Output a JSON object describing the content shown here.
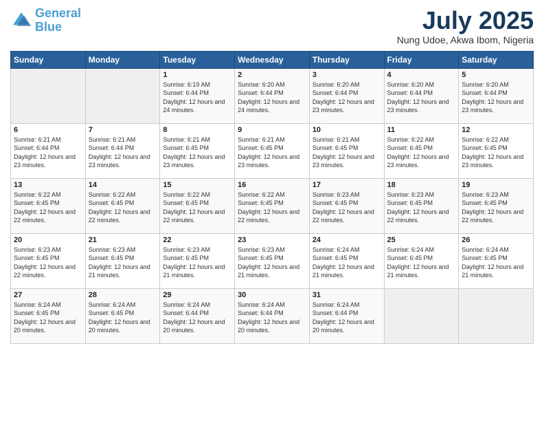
{
  "logo": {
    "text_general": "General",
    "text_blue": "Blue"
  },
  "header": {
    "title": "July 2025",
    "subtitle": "Nung Udoe, Akwa Ibom, Nigeria"
  },
  "weekdays": [
    "Sunday",
    "Monday",
    "Tuesday",
    "Wednesday",
    "Thursday",
    "Friday",
    "Saturday"
  ],
  "weeks": [
    [
      {
        "day": "",
        "sunrise": "",
        "sunset": "",
        "daylight": ""
      },
      {
        "day": "",
        "sunrise": "",
        "sunset": "",
        "daylight": ""
      },
      {
        "day": "1",
        "sunrise": "Sunrise: 6:19 AM",
        "sunset": "Sunset: 6:44 PM",
        "daylight": "Daylight: 12 hours and 24 minutes."
      },
      {
        "day": "2",
        "sunrise": "Sunrise: 6:20 AM",
        "sunset": "Sunset: 6:44 PM",
        "daylight": "Daylight: 12 hours and 24 minutes."
      },
      {
        "day": "3",
        "sunrise": "Sunrise: 6:20 AM",
        "sunset": "Sunset: 6:44 PM",
        "daylight": "Daylight: 12 hours and 23 minutes."
      },
      {
        "day": "4",
        "sunrise": "Sunrise: 6:20 AM",
        "sunset": "Sunset: 6:44 PM",
        "daylight": "Daylight: 12 hours and 23 minutes."
      },
      {
        "day": "5",
        "sunrise": "Sunrise: 6:20 AM",
        "sunset": "Sunset: 6:44 PM",
        "daylight": "Daylight: 12 hours and 23 minutes."
      }
    ],
    [
      {
        "day": "6",
        "sunrise": "Sunrise: 6:21 AM",
        "sunset": "Sunset: 6:44 PM",
        "daylight": "Daylight: 12 hours and 23 minutes."
      },
      {
        "day": "7",
        "sunrise": "Sunrise: 6:21 AM",
        "sunset": "Sunset: 6:44 PM",
        "daylight": "Daylight: 12 hours and 23 minutes."
      },
      {
        "day": "8",
        "sunrise": "Sunrise: 6:21 AM",
        "sunset": "Sunset: 6:45 PM",
        "daylight": "Daylight: 12 hours and 23 minutes."
      },
      {
        "day": "9",
        "sunrise": "Sunrise: 6:21 AM",
        "sunset": "Sunset: 6:45 PM",
        "daylight": "Daylight: 12 hours and 23 minutes."
      },
      {
        "day": "10",
        "sunrise": "Sunrise: 6:21 AM",
        "sunset": "Sunset: 6:45 PM",
        "daylight": "Daylight: 12 hours and 23 minutes."
      },
      {
        "day": "11",
        "sunrise": "Sunrise: 6:22 AM",
        "sunset": "Sunset: 6:45 PM",
        "daylight": "Daylight: 12 hours and 23 minutes."
      },
      {
        "day": "12",
        "sunrise": "Sunrise: 6:22 AM",
        "sunset": "Sunset: 6:45 PM",
        "daylight": "Daylight: 12 hours and 23 minutes."
      }
    ],
    [
      {
        "day": "13",
        "sunrise": "Sunrise: 6:22 AM",
        "sunset": "Sunset: 6:45 PM",
        "daylight": "Daylight: 12 hours and 22 minutes."
      },
      {
        "day": "14",
        "sunrise": "Sunrise: 6:22 AM",
        "sunset": "Sunset: 6:45 PM",
        "daylight": "Daylight: 12 hours and 22 minutes."
      },
      {
        "day": "15",
        "sunrise": "Sunrise: 6:22 AM",
        "sunset": "Sunset: 6:45 PM",
        "daylight": "Daylight: 12 hours and 22 minutes."
      },
      {
        "day": "16",
        "sunrise": "Sunrise: 6:22 AM",
        "sunset": "Sunset: 6:45 PM",
        "daylight": "Daylight: 12 hours and 22 minutes."
      },
      {
        "day": "17",
        "sunrise": "Sunrise: 6:23 AM",
        "sunset": "Sunset: 6:45 PM",
        "daylight": "Daylight: 12 hours and 22 minutes."
      },
      {
        "day": "18",
        "sunrise": "Sunrise: 6:23 AM",
        "sunset": "Sunset: 6:45 PM",
        "daylight": "Daylight: 12 hours and 22 minutes."
      },
      {
        "day": "19",
        "sunrise": "Sunrise: 6:23 AM",
        "sunset": "Sunset: 6:45 PM",
        "daylight": "Daylight: 12 hours and 22 minutes."
      }
    ],
    [
      {
        "day": "20",
        "sunrise": "Sunrise: 6:23 AM",
        "sunset": "Sunset: 6:45 PM",
        "daylight": "Daylight: 12 hours and 22 minutes."
      },
      {
        "day": "21",
        "sunrise": "Sunrise: 6:23 AM",
        "sunset": "Sunset: 6:45 PM",
        "daylight": "Daylight: 12 hours and 21 minutes."
      },
      {
        "day": "22",
        "sunrise": "Sunrise: 6:23 AM",
        "sunset": "Sunset: 6:45 PM",
        "daylight": "Daylight: 12 hours and 21 minutes."
      },
      {
        "day": "23",
        "sunrise": "Sunrise: 6:23 AM",
        "sunset": "Sunset: 6:45 PM",
        "daylight": "Daylight: 12 hours and 21 minutes."
      },
      {
        "day": "24",
        "sunrise": "Sunrise: 6:24 AM",
        "sunset": "Sunset: 6:45 PM",
        "daylight": "Daylight: 12 hours and 21 minutes."
      },
      {
        "day": "25",
        "sunrise": "Sunrise: 6:24 AM",
        "sunset": "Sunset: 6:45 PM",
        "daylight": "Daylight: 12 hours and 21 minutes."
      },
      {
        "day": "26",
        "sunrise": "Sunrise: 6:24 AM",
        "sunset": "Sunset: 6:45 PM",
        "daylight": "Daylight: 12 hours and 21 minutes."
      }
    ],
    [
      {
        "day": "27",
        "sunrise": "Sunrise: 6:24 AM",
        "sunset": "Sunset: 6:45 PM",
        "daylight": "Daylight: 12 hours and 20 minutes."
      },
      {
        "day": "28",
        "sunrise": "Sunrise: 6:24 AM",
        "sunset": "Sunset: 6:45 PM",
        "daylight": "Daylight: 12 hours and 20 minutes."
      },
      {
        "day": "29",
        "sunrise": "Sunrise: 6:24 AM",
        "sunset": "Sunset: 6:44 PM",
        "daylight": "Daylight: 12 hours and 20 minutes."
      },
      {
        "day": "30",
        "sunrise": "Sunrise: 6:24 AM",
        "sunset": "Sunset: 6:44 PM",
        "daylight": "Daylight: 12 hours and 20 minutes."
      },
      {
        "day": "31",
        "sunrise": "Sunrise: 6:24 AM",
        "sunset": "Sunset: 6:44 PM",
        "daylight": "Daylight: 12 hours and 20 minutes."
      },
      {
        "day": "",
        "sunrise": "",
        "sunset": "",
        "daylight": ""
      },
      {
        "day": "",
        "sunrise": "",
        "sunset": "",
        "daylight": ""
      }
    ]
  ]
}
